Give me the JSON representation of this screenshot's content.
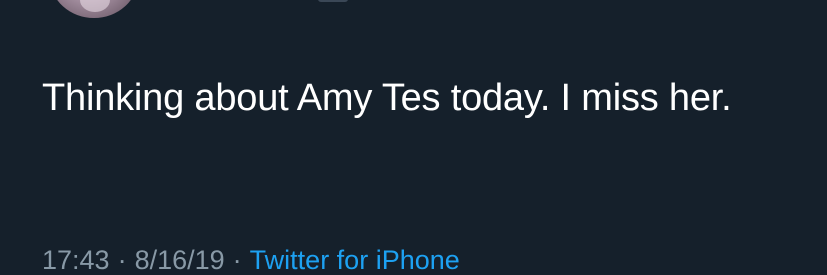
{
  "tweet": {
    "text": "Thinking about Amy Tes today. I miss her.",
    "time": "17:43",
    "separator": "·",
    "date": "8/16/19",
    "source": "Twitter for iPhone"
  },
  "colors": {
    "background": "#15202b",
    "text": "#ffffff",
    "meta": "#8899a6",
    "link": "#1da1f2"
  }
}
